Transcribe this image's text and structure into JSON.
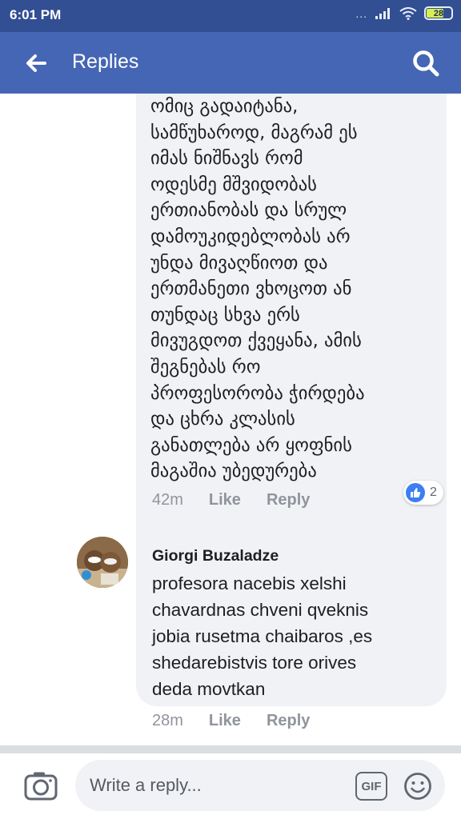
{
  "status_bar": {
    "time": "6:01 PM",
    "signal_dots": "...",
    "battery": "28"
  },
  "header": {
    "title": "Replies",
    "back_icon": "arrow-left-icon",
    "search_icon": "search-icon",
    "color": "#4566b4"
  },
  "comments": [
    {
      "text": "ომიც გადაიტანა,\nსამწუხაროდ, მაგრამ ეს\nიმას ნიშნავს რომ\nოდესმე მშვიდობას\nერთიანობას და სრულ\nდამოუკიდებლობას არ\nუნდა მივაღწიოთ და\nერთმანეთი ვხოცოთ ან\nთუნდაც სხვა ერს\nმივუგდოთ ქვეყანა, ამის\nშეგნებას რო\nპროფესორობა ჭირდება\nდა ცხრა კლასის\nგანათლება არ ყოფნის\nმაგაშია უბედურება",
      "time": "42m",
      "like": "Like",
      "reply": "Reply",
      "reaction_count": "2",
      "reaction_icon": "thumbs-up-icon"
    },
    {
      "author": "Giorgi Buzaladze",
      "text": "profesora nacebis xelshi\nchavardnas chveni qveknis\njobia rusetma chaibaros ,es\nshedarebistvis tore orives\ndeda movtkan",
      "time": "28m",
      "like": "Like",
      "reply": "Reply"
    }
  ],
  "composer": {
    "placeholder": "Write a reply...",
    "gif_label": "GIF",
    "camera_icon": "camera-icon",
    "emoji_icon": "smiley-icon"
  }
}
